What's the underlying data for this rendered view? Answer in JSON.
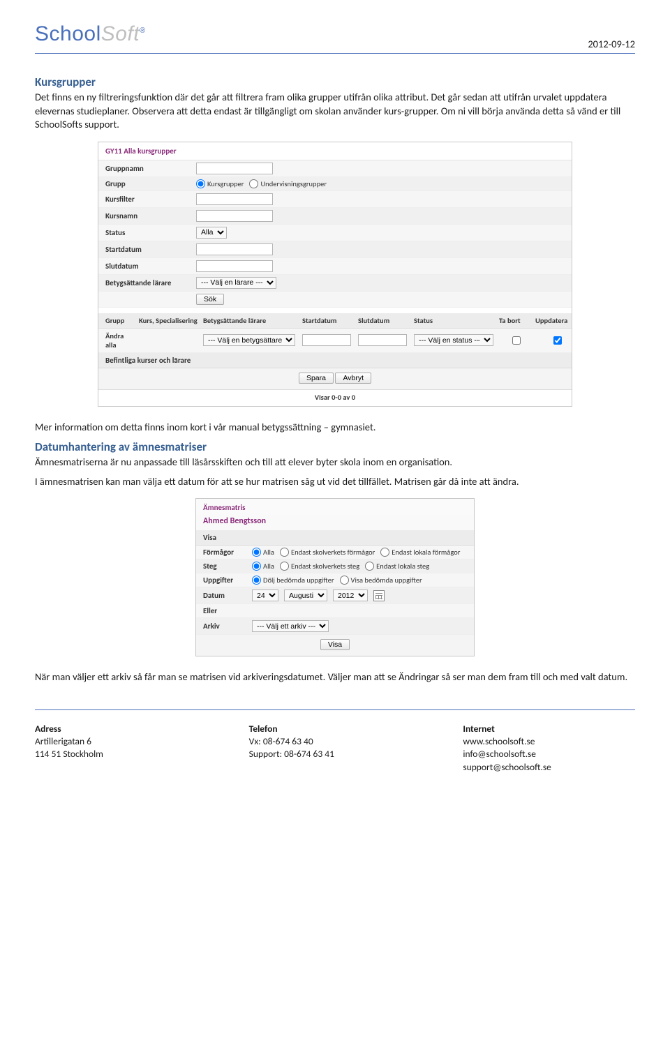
{
  "date": "2012-09-12",
  "logo": {
    "part1": "School",
    "part2": "Soft",
    "registered": "®"
  },
  "h1": "Kursgrupper",
  "p1": "Det finns en ny filtreringsfunktion där det går att filtrera fram olika grupper utifrån olika attribut. Det går sedan att utifrån urvalet uppdatera elevernas studieplaner. Observera att detta endast är tillgängligt om skolan använder kurs-grupper. Om ni vill börja använda detta så vänd er till SchoolSofts support.",
  "shot1": {
    "title": "GY11 Alla kursgrupper",
    "rows": {
      "gruppnamn": "Gruppnamn",
      "grupp": "Grupp",
      "grupp_r1": "Kursgrupper",
      "grupp_r2": "Undervisningsgrupper",
      "kursfilter": "Kursfilter",
      "kursnamn": "Kursnamn",
      "status": "Status",
      "status_val": "Alla",
      "startdatum": "Startdatum",
      "slutdatum": "Slutdatum",
      "betyg": "Betygsättande lärare",
      "betyg_val": "--- Välj en lärare ---",
      "sok": "Sök"
    },
    "thead": {
      "c1": "Grupp",
      "c2": "Kurs, Specialisering",
      "c3": "Betygsättande lärare",
      "c4": "Startdatum",
      "c5": "Slutdatum",
      "c6": "Status",
      "c7": "Ta bort",
      "c8": "Uppdatera"
    },
    "trow": {
      "c1": "Ändra alla",
      "c3_sel": "--- Välj en betygsättare ---",
      "c6_sel": "--- Välj en status ---"
    },
    "section2": "Befintliga kurser och lärare",
    "btn_spara": "Spara",
    "btn_avbryt": "Avbryt",
    "pager": "Visar 0-0 av 0"
  },
  "p2": "Mer information om detta finns inom kort i vår manual betygssättning – gymnasiet.",
  "h2": "Datumhantering av ämnesmatriser",
  "p3": "Ämnesmatriserna är nu anpassade till läsårsskiften och till att elever byter skola inom en organisation.",
  "p4": "I ämnesmatrisen kan man välja ett datum för att se hur matrisen såg ut vid det tillfället. Matrisen går då inte att ändra.",
  "shot2": {
    "title": "Ämnesmatris",
    "name": "Ahmed Bengtsson",
    "visa": "Visa",
    "r_formagor": "Förmågor",
    "r_formagor_o": [
      "Alla",
      "Endast skolverkets förmågor",
      "Endast lokala förmågor"
    ],
    "r_steg": "Steg",
    "r_steg_o": [
      "Alla",
      "Endast skolverkets steg",
      "Endast lokala steg"
    ],
    "r_uppg": "Uppgifter",
    "r_uppg_o": [
      "Dölj bedömda uppgifter",
      "Visa bedömda uppgifter"
    ],
    "r_datum": "Datum",
    "d_day": "24",
    "d_month": "Augusti",
    "d_year": "2012",
    "r_eller": "Eller",
    "r_arkiv": "Arkiv",
    "arkiv_sel": "--- Välj ett arkiv ---",
    "btn_visa": "Visa"
  },
  "p5": "När man väljer ett arkiv så får man se matrisen vid arkiveringsdatumet. Väljer man att se Ändringar så ser man dem fram till och med valt datum.",
  "footer": {
    "adress_h": "Adress",
    "adress_1": "Artillerigatan 6",
    "adress_2": "114 51 Stockholm",
    "tel_h": "Telefon",
    "tel_1": "Vx: 08-674 63 40",
    "tel_2": "Support: 08-674 63 41",
    "net_h": "Internet",
    "net_1": "www.schoolsoft.se",
    "net_2": "info@schoolsoft.se",
    "net_3": "support@schoolsoft.se"
  }
}
